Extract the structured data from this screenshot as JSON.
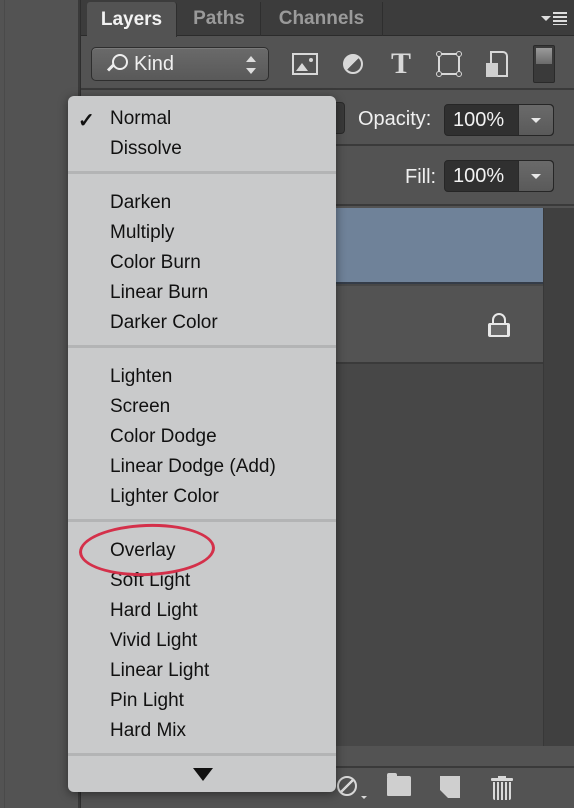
{
  "panel": {
    "tabs": [
      {
        "label": "Layers",
        "active": true
      },
      {
        "label": "Paths",
        "active": false
      },
      {
        "label": "Channels",
        "active": false
      }
    ],
    "menu_icon": "panel-menu-icon"
  },
  "filter": {
    "kind_label": "Kind",
    "icons": [
      "image-filter-icon",
      "adjustment-filter-icon",
      "type-filter-icon",
      "shape-filter-icon",
      "smart-object-filter-icon",
      "filter-toggle"
    ]
  },
  "opacity": {
    "label": "Opacity:",
    "value": "100%"
  },
  "fill": {
    "label": "Fill:",
    "value": "100%"
  },
  "layers": {
    "selected_color": "#6f8299",
    "background_locked": true
  },
  "blend_menu": {
    "selected": "Normal",
    "highlighted": "Overlay",
    "highlight_color": "#d4304a",
    "groups": [
      [
        "Normal",
        "Dissolve"
      ],
      [
        "Darken",
        "Multiply",
        "Color Burn",
        "Linear Burn",
        "Darker Color"
      ],
      [
        "Lighten",
        "Screen",
        "Color Dodge",
        "Linear Dodge (Add)",
        "Lighter Color"
      ],
      [
        "Overlay",
        "Soft Light",
        "Hard Light",
        "Vivid Light",
        "Linear Light",
        "Pin Light",
        "Hard Mix"
      ]
    ],
    "more_indicator": "scroll-down-arrow"
  },
  "footer": {
    "icons": [
      "new-adjustment-layer-icon",
      "new-group-icon",
      "new-layer-icon",
      "delete-layer-icon"
    ]
  }
}
